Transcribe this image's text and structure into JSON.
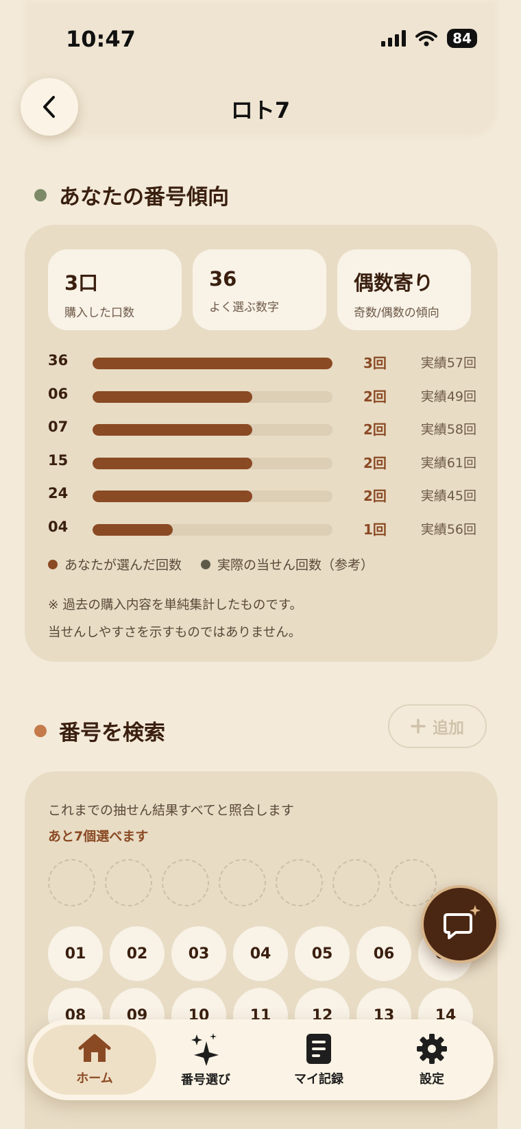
{
  "status": {
    "time": "10:47",
    "battery": "84"
  },
  "nav": {
    "title": "ロト7"
  },
  "trend": {
    "title": "あなたの番号傾向",
    "stats": [
      {
        "value": "3口",
        "label": "購入した口数"
      },
      {
        "value": "36",
        "label": "よく選ぶ数字"
      },
      {
        "value": "偶数寄り",
        "label": "奇数/偶数の傾向"
      }
    ],
    "bars": [
      {
        "number": "36",
        "fill": 1.0,
        "count": "3回",
        "actual": "実績57回"
      },
      {
        "number": "06",
        "fill": 0.667,
        "count": "2回",
        "actual": "実績49回"
      },
      {
        "number": "07",
        "fill": 0.667,
        "count": "2回",
        "actual": "実績58回"
      },
      {
        "number": "15",
        "fill": 0.667,
        "count": "2回",
        "actual": "実績61回"
      },
      {
        "number": "24",
        "fill": 0.667,
        "count": "2回",
        "actual": "実績45回"
      },
      {
        "number": "04",
        "fill": 0.333,
        "count": "1回",
        "actual": "実績56回"
      }
    ],
    "legend": {
      "mine": "あなたが選んだ回数",
      "actual": "実際の当せん回数（参考）"
    },
    "note_line1": "※ 過去の購入内容を単純集計したものです。",
    "note_line2": "当せんしやすさを示すものではありません。"
  },
  "search": {
    "title": "番号を検索",
    "add_label": "追加",
    "description": "これまでの抽せん結果すべてと照合します",
    "remaining": "あと7個選べます",
    "numbers": [
      "01",
      "02",
      "03",
      "04",
      "05",
      "06",
      "07",
      "08",
      "09",
      "10",
      "11",
      "12",
      "13",
      "14"
    ]
  },
  "tabs": {
    "home": "ホーム",
    "pick": "番号選び",
    "records": "マイ記録",
    "settings": "設定"
  },
  "colors": {
    "accent": "#8a4a24",
    "background": "#f3ead9",
    "card": "#e8dcc5",
    "trend_dot": "#7d8a68",
    "search_dot": "#c47a4a"
  }
}
